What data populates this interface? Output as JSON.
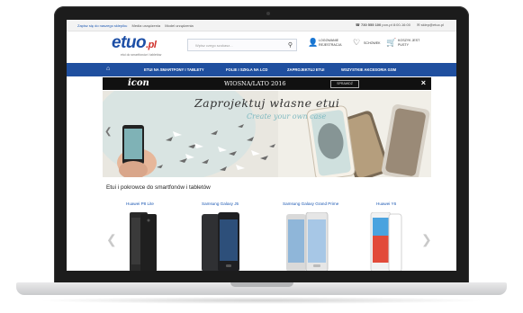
{
  "topbar": {
    "left_items": [
      "Zapisz się do naszego sklepiku",
      "Media urządzenia",
      "Model urządzenia"
    ],
    "phone": "730 555 100",
    "hours": "pon-pt 8:00-16:00",
    "email": "sklep@etuo.pl"
  },
  "header": {
    "logo": "etuo",
    "logo_tld": ".pl",
    "logo_sub": "etui do smartfonów i tabletów",
    "search_placeholder": "Wpisz czego szukasz...",
    "account_label": "LOGOWANIE REJESTRACJA",
    "wishlist_label": "SCHOWEK",
    "cart_label": "KOSZYK JEST PUSTY"
  },
  "nav": {
    "items": [
      "ETUI NA SMARTFONY I TABLETY",
      "FOLIE I SZKŁA NA LCD",
      "ZAPROJEKTUJ ETUI",
      "WSZYSTKIE AKCESORIA GSM"
    ]
  },
  "banner": {
    "brand": "icon",
    "season": "WIOSNA/LATO 2016",
    "button": "SPRAWDŹ"
  },
  "hero": {
    "title": "Zaprojektuj własne etui",
    "subtitle": "Create your own case"
  },
  "section": {
    "title": "Etui i pokrowce do smartfonów i tabletów"
  },
  "products": [
    {
      "name": "Huawei P8 Lite",
      "color": "#2a2a2a"
    },
    {
      "name": "Samsung Galaxy J5",
      "color": "#2f3033"
    },
    {
      "name": "Samsung Galaxy Grand Prime",
      "color": "#d9d9d9"
    },
    {
      "name": "Huawei Y6",
      "color": "#f2f2f2"
    }
  ],
  "colors": {
    "nav": "#1f4f9f",
    "logo": "#1d4fa6",
    "accent": "#d0302a"
  }
}
